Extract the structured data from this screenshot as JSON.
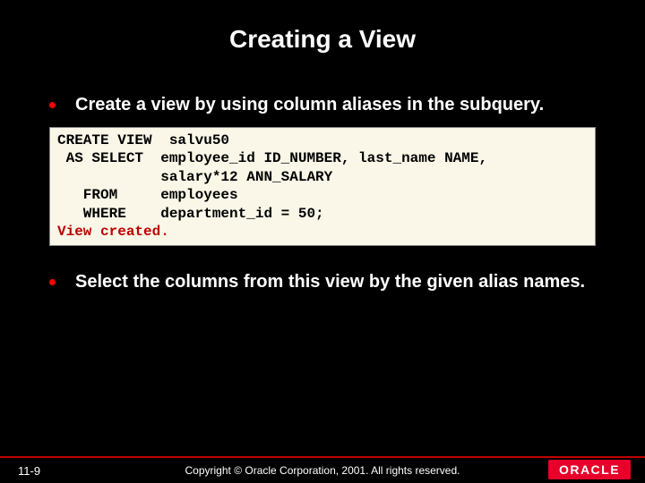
{
  "title": "Creating a View",
  "bullets": [
    "Create a view by using column aliases in the subquery.",
    "Select the columns from this view by the given alias names."
  ],
  "code": {
    "lines": "CREATE VIEW  salvu50\n AS SELECT  employee_id ID_NUMBER, last_name NAME,\n            salary*12 ANN_SALARY\n   FROM     employees\n   WHERE    department_id = 50;",
    "result": "View created."
  },
  "footer": {
    "slide_number": "11-9",
    "copyright": "Copyright © Oracle Corporation, 2001. All rights reserved."
  },
  "logo": "ORACLE"
}
